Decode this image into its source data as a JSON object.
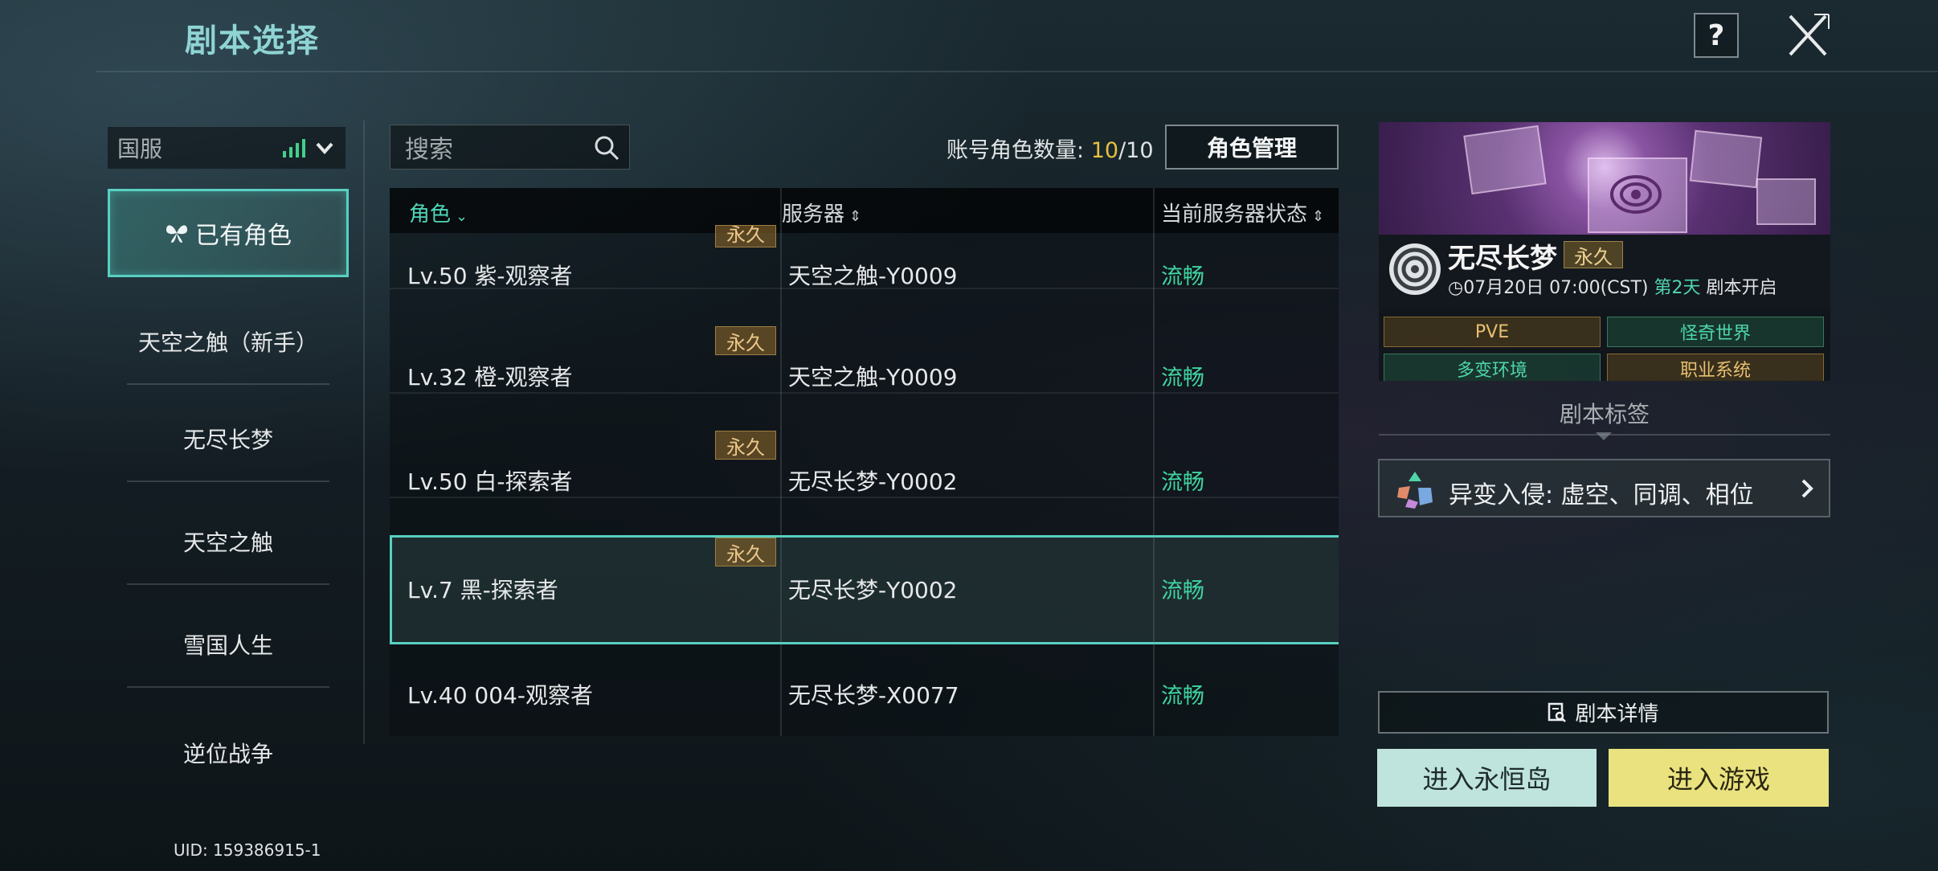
{
  "header": {
    "title": "剧本选择",
    "help_label": "?"
  },
  "sidebar": {
    "region": "国服",
    "items": [
      {
        "label": "已有角色",
        "selected": true
      },
      {
        "label": "天空之触（新手）"
      },
      {
        "label": "无尽长梦"
      },
      {
        "label": "天空之触"
      },
      {
        "label": "雪国人生"
      },
      {
        "label": "逆位战争"
      }
    ],
    "uid": "UID: 159386915-1"
  },
  "search": {
    "placeholder": "搜索"
  },
  "account": {
    "label": "账号角色数量:",
    "current": "10",
    "separator": "/",
    "max": "10",
    "manage_button": "角色管理"
  },
  "table": {
    "columns": [
      "角色",
      "服务器",
      "当前服务器状态"
    ],
    "rows": [
      {
        "name": "Lv.50 紫-观察者",
        "server": "天空之触-Y0009",
        "status": "流畅",
        "badge": "永久"
      },
      {
        "name": "Lv.32 橙-观察者",
        "server": "天空之触-Y0009",
        "status": "流畅",
        "badge": "永久"
      },
      {
        "name": "Lv.50 白-探索者",
        "server": "无尽长梦-Y0002",
        "status": "流畅",
        "badge": "永久"
      },
      {
        "name": "Lv.7 黑-探索者",
        "server": "无尽长梦-Y0002",
        "status": "流畅",
        "badge": "永久",
        "selected": true
      },
      {
        "name": "Lv.40 004-观察者",
        "server": "无尽长梦-X0077",
        "status": "流畅",
        "badge": ""
      }
    ]
  },
  "scenario": {
    "name": "无尽长梦",
    "badge": "永久",
    "time_prefix": "07月20日 07:00(CST) ",
    "day": "第2天",
    "time_suffix": "  剧本开启",
    "tags": [
      "PVE",
      "怪奇世界",
      "多变环境",
      "职业系统"
    ],
    "tag_section_label": "剧本标签",
    "mutation": "异变入侵: 虚空、同调、相位",
    "details_button": "剧本详情",
    "enter_island_button": "进入永恒岛",
    "enter_game_button": "进入游戏"
  },
  "colors": {
    "accent_teal": "#58d0c2",
    "status_green": "#3fd4a0",
    "count_gold": "#e8c040",
    "enter_island_bg": "#bfe3dd",
    "enter_game_bg": "#e9e27f"
  }
}
